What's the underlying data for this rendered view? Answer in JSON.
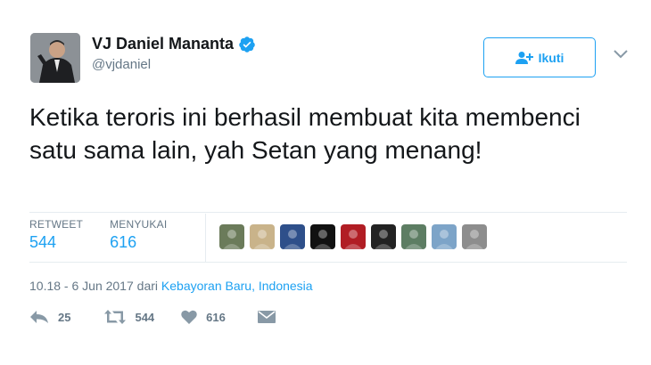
{
  "user": {
    "name": "VJ Daniel Mananta",
    "handle": "@vjdaniel",
    "verified": true
  },
  "follow_button": {
    "label": "Ikuti",
    "icon": "add-user-icon"
  },
  "menu_icon": "chevron-down-icon",
  "tweet": {
    "text": "Ketika teroris ini berhasil membuat kita membenci satu sama lain, yah Setan yang menang!"
  },
  "stats": {
    "retweets_label": "RETWEET",
    "retweets_value": "544",
    "likes_label": "MENYUKAI",
    "likes_value": "616"
  },
  "likers": [
    {
      "color": "#6b7b5a"
    },
    {
      "color": "#c9b38a"
    },
    {
      "color": "#2e4f8a"
    },
    {
      "color": "#111111"
    },
    {
      "color": "#b11d24"
    },
    {
      "color": "#222222"
    },
    {
      "color": "#5d7d63"
    },
    {
      "color": "#7da4c8"
    },
    {
      "color": "#8d8d8d"
    }
  ],
  "meta": {
    "time": "10.18 - 6 Jun 2017",
    "from": "dari",
    "location": "Kebayoran Baru, Indonesia"
  },
  "actions": {
    "reply_count": "25",
    "retweet_count": "544",
    "like_count": "616"
  },
  "colors": {
    "accent": "#1da1f2",
    "muted": "#657786",
    "divider": "#e6ecf0"
  }
}
